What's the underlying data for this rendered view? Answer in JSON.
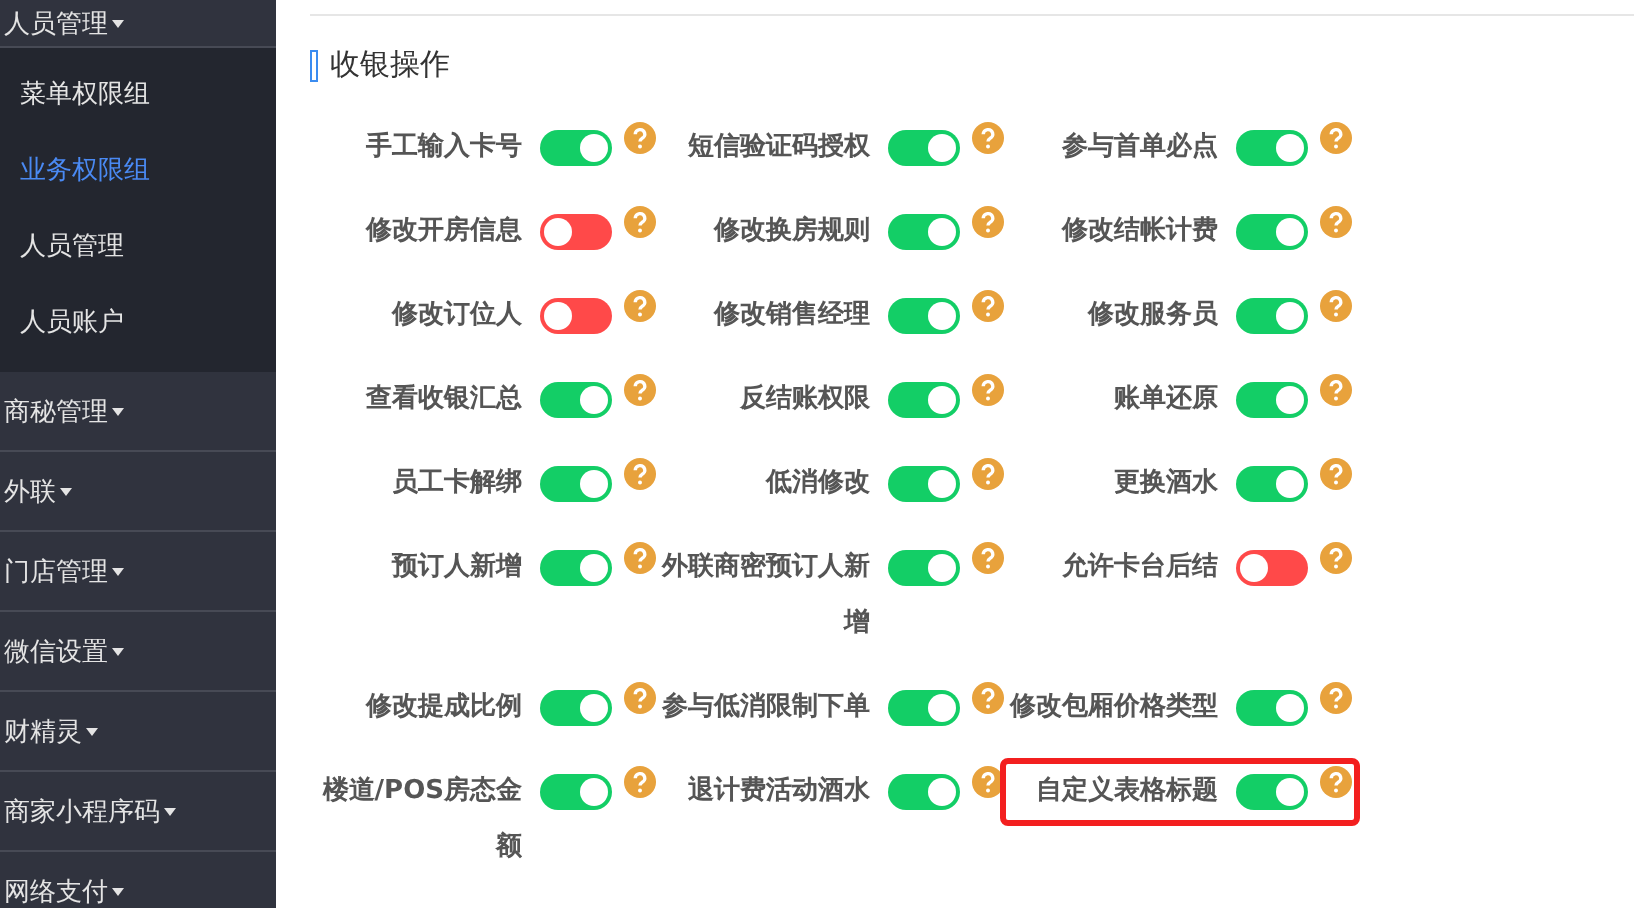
{
  "sidebar": {
    "items": [
      {
        "label": "人员管理",
        "children": [
          {
            "label": "菜单权限组",
            "selected": false
          },
          {
            "label": "业务权限组",
            "selected": true
          },
          {
            "label": "人员管理",
            "selected": false
          },
          {
            "label": "人员账户",
            "selected": false
          }
        ]
      },
      {
        "label": "商秘管理"
      },
      {
        "label": "外联"
      },
      {
        "label": "门店管理"
      },
      {
        "label": "微信设置"
      },
      {
        "label": "财精灵"
      },
      {
        "label": "商家小程序码"
      },
      {
        "label": "网络支付"
      }
    ]
  },
  "section": {
    "title": "收银操作",
    "settings": [
      {
        "label": "手工输入卡号",
        "on": true,
        "highlighted": false
      },
      {
        "label": "短信验证码授权",
        "on": true,
        "highlighted": false
      },
      {
        "label": "参与首单必点",
        "on": true,
        "highlighted": false
      },
      {
        "label": "修改开房信息",
        "on": false,
        "highlighted": false
      },
      {
        "label": "修改换房规则",
        "on": true,
        "highlighted": false
      },
      {
        "label": "修改结帐计费",
        "on": true,
        "highlighted": false
      },
      {
        "label": "修改订位人",
        "on": false,
        "highlighted": false
      },
      {
        "label": "修改销售经理",
        "on": true,
        "highlighted": false
      },
      {
        "label": "修改服务员",
        "on": true,
        "highlighted": false
      },
      {
        "label": "查看收银汇总",
        "on": true,
        "highlighted": false
      },
      {
        "label": "反结账权限",
        "on": true,
        "highlighted": false
      },
      {
        "label": "账单还原",
        "on": true,
        "highlighted": false
      },
      {
        "label": "员工卡解绑",
        "on": true,
        "highlighted": false
      },
      {
        "label": "低消修改",
        "on": true,
        "highlighted": false
      },
      {
        "label": "更换酒水",
        "on": true,
        "highlighted": false
      },
      {
        "label": "预订人新增",
        "on": true,
        "highlighted": false
      },
      {
        "label": "外联商密预订人新增",
        "on": true,
        "highlighted": false
      },
      {
        "label": "允许卡台后结",
        "on": false,
        "highlighted": false
      },
      {
        "label": "修改提成比例",
        "on": true,
        "highlighted": false
      },
      {
        "label": "参与低消限制下单",
        "on": true,
        "highlighted": false
      },
      {
        "label": "修改包厢价格类型",
        "on": true,
        "highlighted": false
      },
      {
        "label": "楼道/POS房态金额",
        "on": true,
        "highlighted": false
      },
      {
        "label": "退计费活动酒水",
        "on": true,
        "highlighted": false
      },
      {
        "label": "自定义表格标题",
        "on": true,
        "highlighted": true
      }
    ]
  }
}
